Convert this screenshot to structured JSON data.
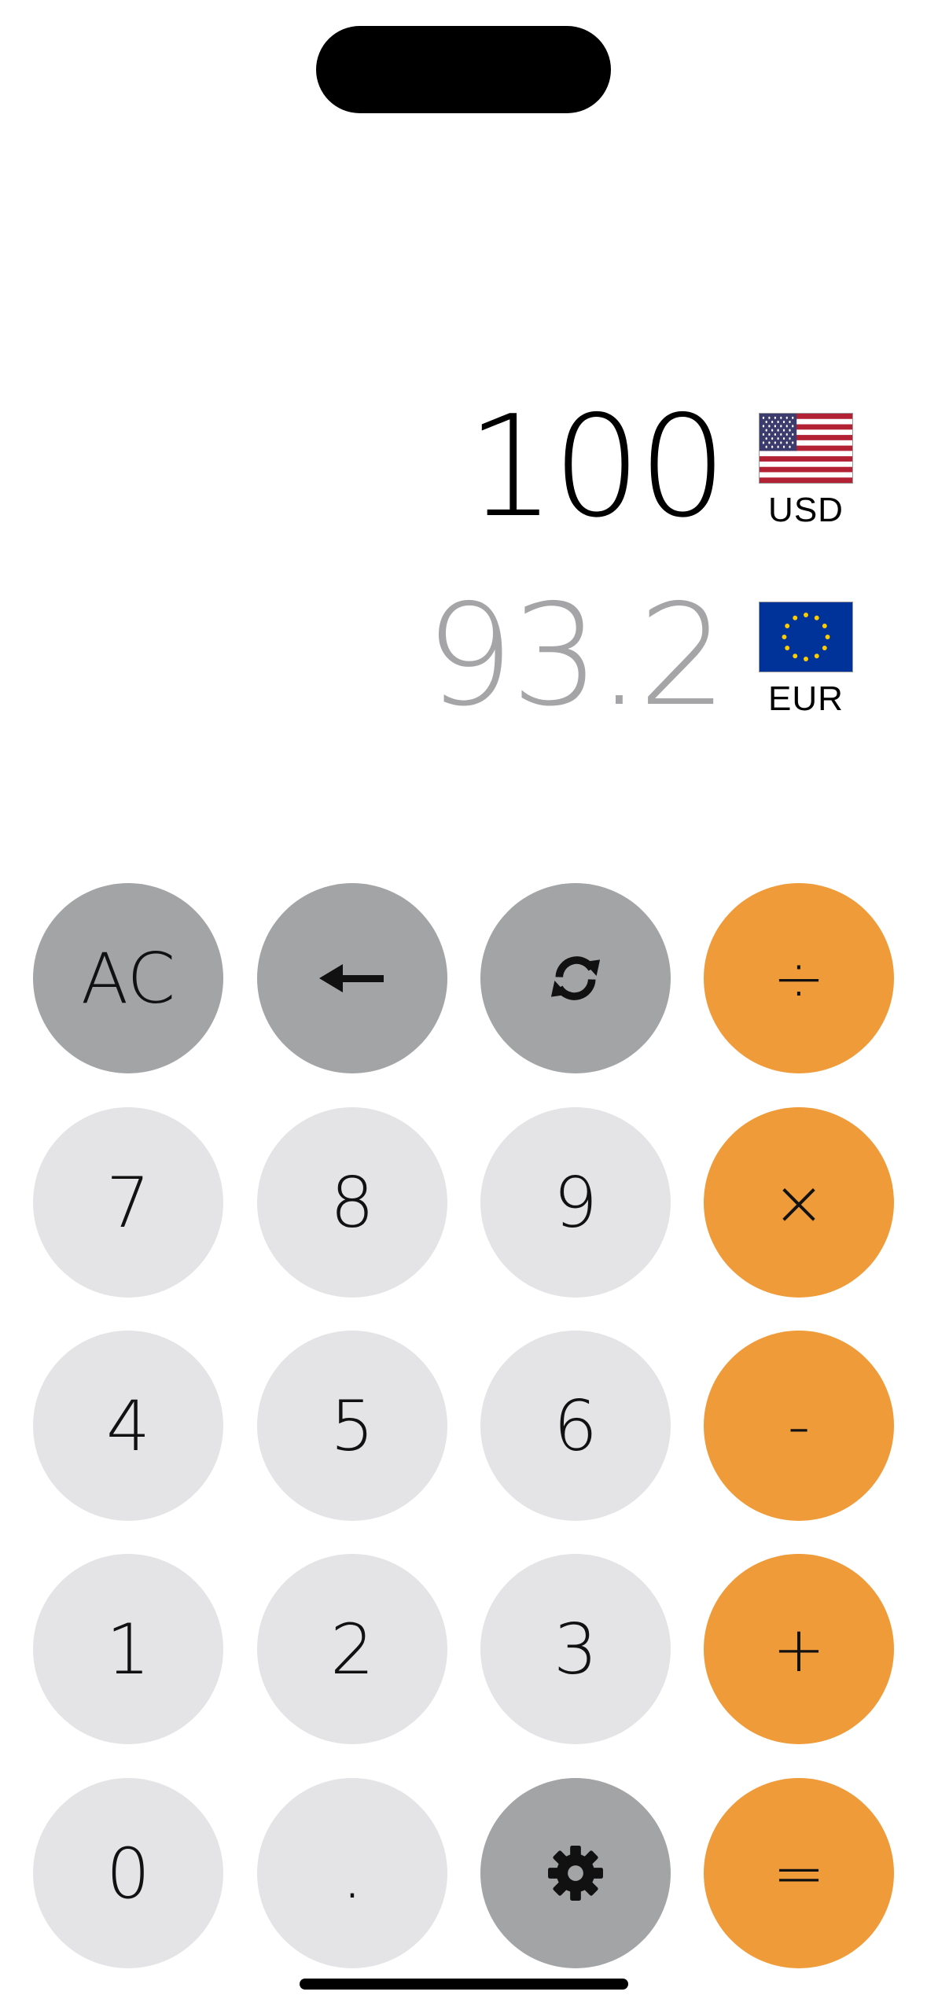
{
  "display": {
    "primary": {
      "amount": "100",
      "currency_code": "USD",
      "flag_icon": "us-flag-icon"
    },
    "secondary": {
      "amount": "93.2",
      "currency_code": "EUR",
      "flag_icon": "eu-flag-icon"
    }
  },
  "keypad": {
    "clear": "AC",
    "backspace_icon": "left-arrow-icon",
    "swap_icon": "refresh-icon",
    "divide": "÷",
    "multiply": "×",
    "subtract": "-",
    "add": "+",
    "equals": "=",
    "decimal": ".",
    "settings_icon": "gear-icon",
    "digits": {
      "d0": "0",
      "d1": "1",
      "d2": "2",
      "d3": "3",
      "d4": "4",
      "d5": "5",
      "d6": "6",
      "d7": "7",
      "d8": "8",
      "d9": "9"
    }
  },
  "colors": {
    "digit_key": "#e4e4e6",
    "function_key": "#a3a4a6",
    "operator_key": "#ef9b3a",
    "secondary_amount": "#a5a5a7"
  }
}
